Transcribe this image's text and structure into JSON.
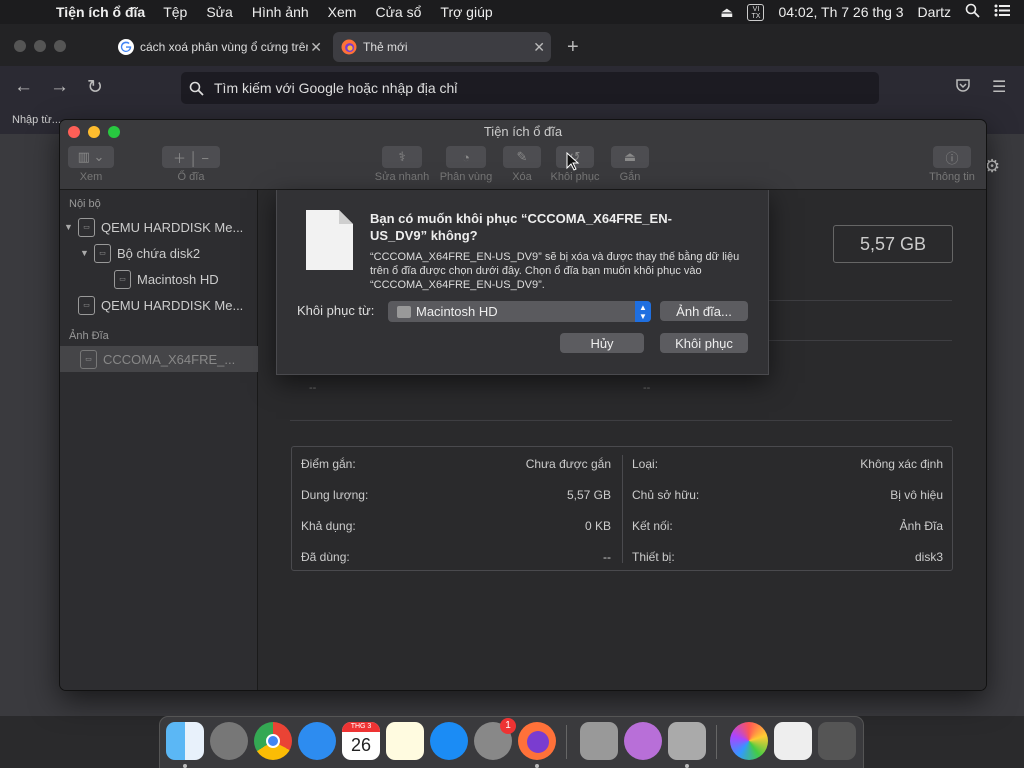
{
  "menubar": {
    "app_name": "Tiện ích ổ đĩa",
    "menus": [
      "Tệp",
      "Sửa",
      "Hình ảnh",
      "Xem",
      "Cửa sổ",
      "Trợ giúp"
    ],
    "input_badge": "VI TX",
    "clock": "04:02, Th 7 26 thg 3",
    "user": "Dartz"
  },
  "browser": {
    "tabs": [
      {
        "title": "cách xoá phân vùng ổ cứng trên",
        "active": false
      },
      {
        "title": "Thẻ mới",
        "active": true
      }
    ],
    "url_placeholder": "Tìm kiếm với Google hoặc nhập địa chỉ",
    "bookmark": "Nhập từ..."
  },
  "disk_utility": {
    "title": "Tiện ích ổ đĩa",
    "toolbar": {
      "view": "Xem",
      "volume": "Ổ đĩa",
      "first_aid": "Sửa nhanh",
      "partition": "Phân vùng",
      "erase": "Xóa",
      "restore": "Khôi phục",
      "mount": "Gắn",
      "info": "Thông tin"
    },
    "sidebar": {
      "section_internal": "Nội bộ",
      "items": [
        {
          "label": "QEMU HARDDISK Me...",
          "level": 0
        },
        {
          "label": "Bộ chứa disk2",
          "level": 1
        },
        {
          "label": "Macintosh HD",
          "level": 2
        },
        {
          "label": "QEMU HARDDISK Me...",
          "level": 0
        }
      ],
      "section_images": "Ảnh Đĩa",
      "image_item": "CCCOMA_X64FRE_..."
    },
    "capacity": "5,57 GB",
    "dash_value": "--",
    "info_left": [
      {
        "label": "Điểm gắn:",
        "value": "Chưa được gắn"
      },
      {
        "label": "Dung lượng:",
        "value": "5,57 GB"
      },
      {
        "label": "Khả dụng:",
        "value": "0 KB"
      },
      {
        "label": "Đã dùng:",
        "value": "--"
      }
    ],
    "info_right": [
      {
        "label": "Loại:",
        "value": "Không xác định"
      },
      {
        "label": "Chủ sở hữu:",
        "value": "Bị vô hiệu"
      },
      {
        "label": "Kết nối:",
        "value": "Ảnh Đĩa"
      },
      {
        "label": "Thiết bị:",
        "value": "disk3"
      }
    ]
  },
  "dialog": {
    "title": "Bạn có muốn khôi phục “CCCOMA_X64FRE_EN-US_DV9” không?",
    "message": "“CCCOMA_X64FRE_EN-US_DV9” sẽ bị xóa và được thay thế bằng dữ liệu trên ổ đĩa được chọn dưới đây. Chọn ổ đĩa bạn muốn khôi phục vào “CCCOMA_X64FRE_EN-US_DV9”.",
    "restore_from_label": "Khôi phục từ:",
    "restore_from_value": "Macintosh HD",
    "image_button": "Ảnh đĩa...",
    "cancel_button": "Hủy",
    "restore_button": "Khôi phục"
  },
  "dock": {
    "calendar_month": "THG 3",
    "calendar_day": "26",
    "settings_badge": "1"
  },
  "colors": {
    "accent_blue": "#1f6fe0",
    "close_red": "#fe5f57",
    "min_yellow": "#febc2e",
    "max_green": "#28c840"
  }
}
